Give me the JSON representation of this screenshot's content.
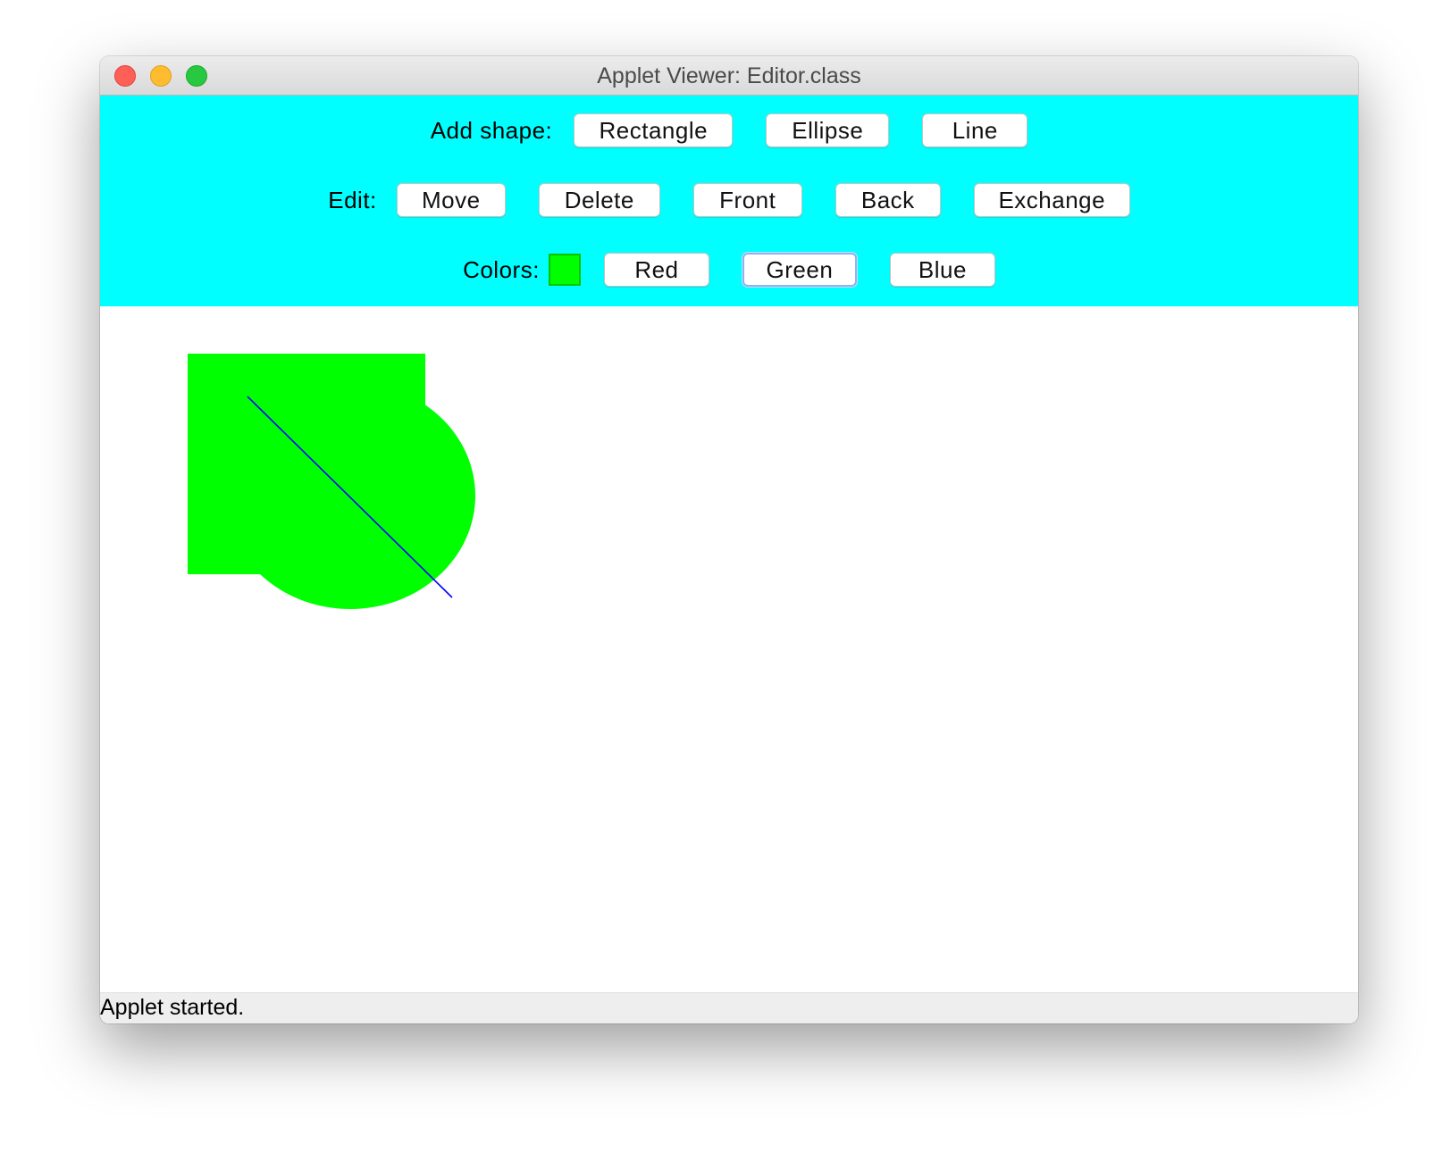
{
  "window": {
    "title": "Applet Viewer: Editor.class"
  },
  "toolbar": {
    "background": "#00ffff",
    "add_shape": {
      "label": "Add shape:",
      "buttons": [
        "Rectangle",
        "Ellipse",
        "Line"
      ]
    },
    "edit": {
      "label": "Edit:",
      "buttons": [
        "Move",
        "Delete",
        "Front",
        "Back",
        "Exchange"
      ]
    },
    "colors": {
      "label": "Colors:",
      "current_color": "#00ff00",
      "buttons": [
        "Red",
        "Green",
        "Blue"
      ],
      "focused_button": "Green"
    }
  },
  "canvas": {
    "shapes": [
      {
        "type": "rectangle",
        "color": "#00ff00"
      },
      {
        "type": "ellipse",
        "color": "#00ff00"
      },
      {
        "type": "line",
        "color": "#0000ff"
      }
    ]
  },
  "status": {
    "text": "Applet started."
  }
}
